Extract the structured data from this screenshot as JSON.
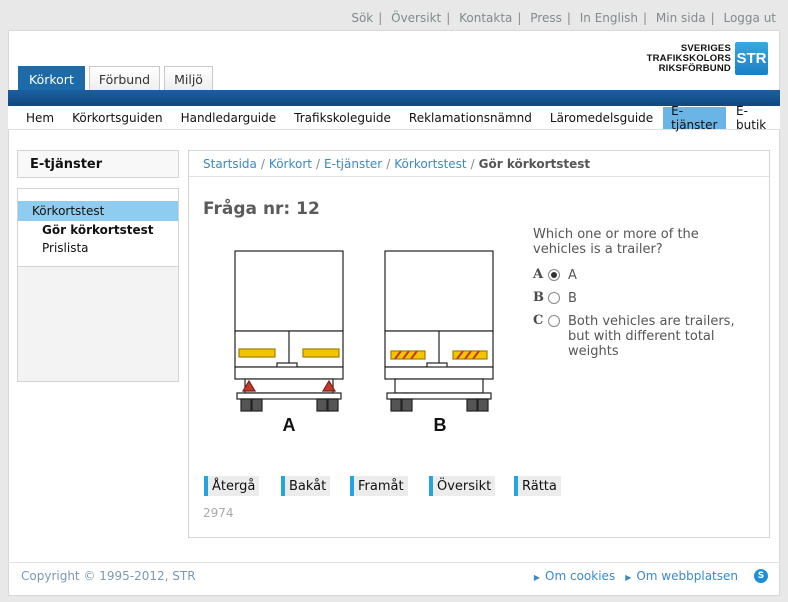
{
  "toplinks": [
    "Sök",
    "Översikt",
    "Kontakta",
    "Press",
    "In English",
    "Min sida",
    "Logga ut"
  ],
  "logo": {
    "line1": "SVERIGES",
    "line2": "TRAFIKSKOLORS",
    "line3": "RIKSFÖRBUND",
    "box": "STR"
  },
  "tabs": [
    "Körkort",
    "Förbund",
    "Miljö"
  ],
  "menu": [
    "Hem",
    "Körkortsguiden",
    "Handledarguide",
    "Trafikskoleguide",
    "Reklamationsnämnd",
    "Läromedelsguide",
    "E-tjänster",
    "E-butik"
  ],
  "sidebar": {
    "title": "E-tjänster",
    "items": {
      "active": "Körkortstest",
      "sub1": "Gör körkortstest",
      "sub2": "Prislista"
    }
  },
  "breadcrumb": {
    "c1": "Startsida",
    "c2": "Körkort",
    "c3": "E-tjänster",
    "c4": "Körkortstest",
    "current": "Gör körkortstest"
  },
  "question": {
    "title": "Fråga nr: 12",
    "text": "Which one or more of the vehicles is a trailer?",
    "image_labels": [
      "A",
      "B"
    ],
    "options": [
      {
        "letter": "A",
        "text": "A",
        "selected": true
      },
      {
        "letter": "B",
        "text": "B",
        "selected": false
      },
      {
        "letter": "C",
        "text": "Both vehicles are trailers, but with different total weights",
        "selected": false
      }
    ],
    "number": "2974"
  },
  "buttons": {
    "back": "Återgå",
    "prev": "Bakåt",
    "next": "Framåt",
    "overview": "Översikt",
    "correct": "Rätta"
  },
  "footer": {
    "copyright": "Copyright © 1995-2012, STR",
    "cookies": "Om cookies",
    "about": "Om webbplatsen"
  },
  "colors": {
    "brand_blue": "#1d6aa8",
    "accent": "#26a4dc",
    "link": "#3a8ac6",
    "active_menu": "#6bb5e6"
  }
}
